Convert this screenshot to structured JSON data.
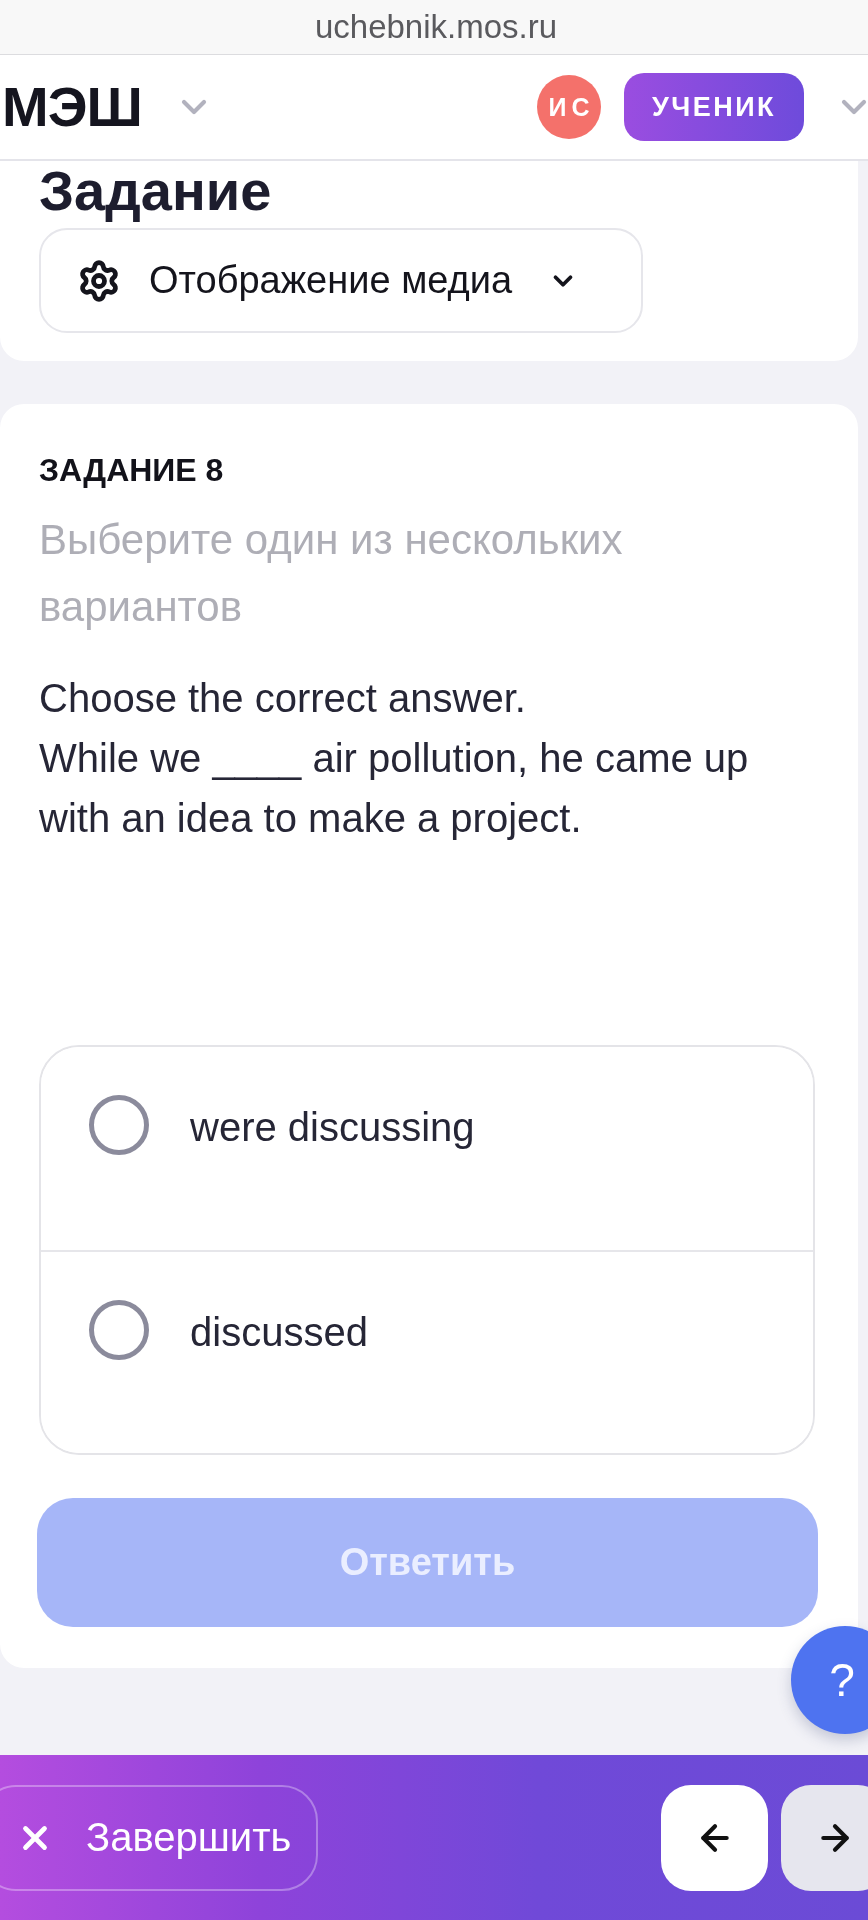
{
  "browser": {
    "url": "uchebnik.mos.ru"
  },
  "header": {
    "logo": "МЭШ",
    "avatar_initials": "ИС",
    "role_button": "УЧЕНИК"
  },
  "task_card": {
    "heading": "Задание",
    "media_dropdown": {
      "label": "Отображение медиа",
      "expanded": false
    }
  },
  "question": {
    "number_label": "ЗАДАНИЕ 8",
    "instruction": "Выберите один из нескольких вариантов",
    "prompt_lines": [
      "Choose the correct answer.",
      "While we ____ air pollution, he came up with an idea to make a project."
    ],
    "options": [
      {
        "label": "were discussing",
        "selected": false
      },
      {
        "label": "discussed",
        "selected": false
      }
    ],
    "submit_button": {
      "label": "Ответить",
      "disabled": true
    }
  },
  "help_button": {
    "label": "?"
  },
  "bottom_bar": {
    "finish_button": "Завершить"
  }
}
